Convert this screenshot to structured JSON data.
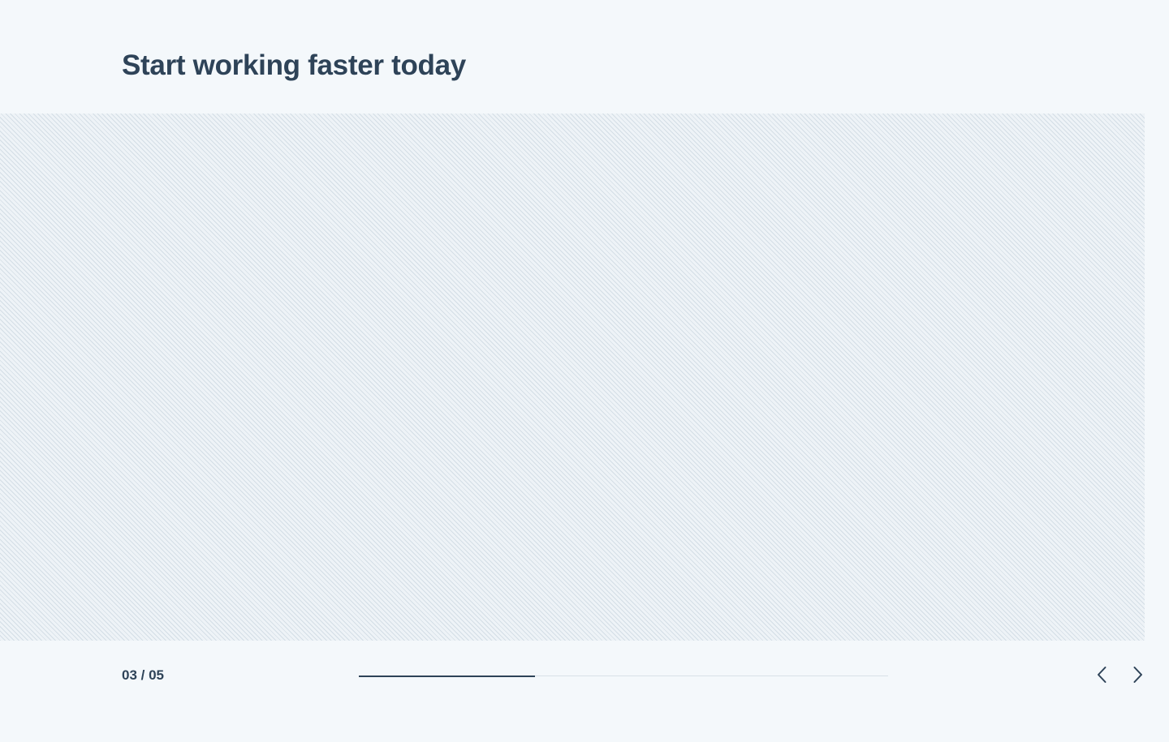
{
  "header": {
    "title": "Start working faster today"
  },
  "slider": {
    "counter": "03 / 05",
    "current": 3,
    "total": 5,
    "progress_fraction": 0.333
  },
  "controls": {
    "prev_icon": "chevron-left-icon",
    "next_icon": "chevron-right-icon"
  },
  "colors": {
    "text": "#2e4358",
    "background": "#f4f8fb",
    "track": "#d8e0e7",
    "fill": "#2e4358"
  }
}
